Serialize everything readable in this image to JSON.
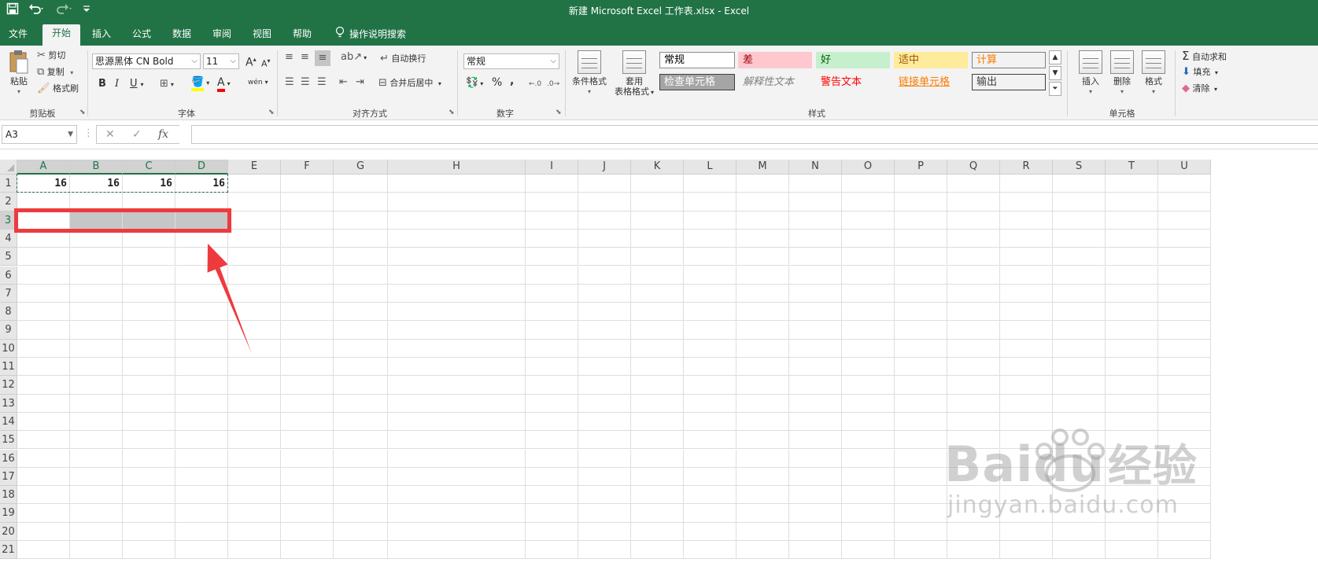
{
  "titlebar": {
    "save_icon": "save-icon",
    "undo_icon": "undo-icon",
    "redo_icon": "redo-icon",
    "customize_icon": "customize-qat-icon",
    "title": "新建 Microsoft Excel 工作表.xlsx  -  Excel"
  },
  "tabs": [
    {
      "label": "文件"
    },
    {
      "label": "开始",
      "active": true
    },
    {
      "label": "插入"
    },
    {
      "label": "公式"
    },
    {
      "label": "数据"
    },
    {
      "label": "审阅"
    },
    {
      "label": "视图"
    },
    {
      "label": "帮助"
    },
    {
      "label": "操作说明搜索",
      "icon": "lightbulb-icon"
    }
  ],
  "ribbon": {
    "clipboard": {
      "paste": "粘贴",
      "cut": "剪切",
      "copy": "复制",
      "format_painter": "格式刷",
      "label": "剪贴板"
    },
    "font": {
      "font_name": "思源黑体 CN Bold",
      "font_size": "11",
      "grow": "A",
      "shrink": "A",
      "bold": "B",
      "italic": "I",
      "underline": "U",
      "font_color": "A",
      "phonetic": "wén",
      "label": "字体"
    },
    "alignment": {
      "wrap_text": "自动换行",
      "merge_center": "合并后居中",
      "label": "对齐方式"
    },
    "number": {
      "format": "常规",
      "percent": "%",
      "comma": ",",
      "label": "数字"
    },
    "styles": {
      "conditional": "条件格式",
      "table_line1": "套用",
      "table_line2": "表格格式",
      "cells": [
        {
          "label": "常规",
          "bg": "#ffffff",
          "fg": "#000000",
          "border": "#8a8a8a"
        },
        {
          "label": "差",
          "bg": "#ffc7ce",
          "fg": "#9c0006",
          "border": "#ffc7ce"
        },
        {
          "label": "好",
          "bg": "#c6efce",
          "fg": "#006100",
          "border": "#c6efce"
        },
        {
          "label": "适中",
          "bg": "#ffeb9c",
          "fg": "#9c5700",
          "border": "#ffeb9c"
        },
        {
          "label": "计算",
          "bg": "#f2f2f2",
          "fg": "#fa7d00",
          "border": "#7f7f7f"
        },
        {
          "label": "检查单元格",
          "bg": "#a5a5a5",
          "fg": "#ffffff",
          "border": "#3f3f3f"
        },
        {
          "label": "解释性文本",
          "bg": "#f3f3f3",
          "fg": "#7f7f7f",
          "border": "#f3f3f3"
        },
        {
          "label": "警告文本",
          "bg": "#f3f3f3",
          "fg": "#ff0000",
          "border": "#f3f3f3"
        },
        {
          "label": "链接单元格",
          "bg": "#f3f3f3",
          "fg": "#fa7d00",
          "border": "#f3f3f3"
        },
        {
          "label": "输出",
          "bg": "#f2f2f2",
          "fg": "#3f3f3f",
          "border": "#3f3f3f"
        }
      ],
      "label": "样式"
    },
    "cells": {
      "insert": "插入",
      "delete": "删除",
      "format": "格式",
      "label": "单元格"
    },
    "editing": {
      "autosum": "自动求和",
      "fill": "填充",
      "clear": "清除"
    }
  },
  "formula_bar": {
    "name_box": "A3",
    "cancel": "✕",
    "enter": "✓",
    "fx": "fx",
    "value": ""
  },
  "sheet": {
    "columns": [
      "A",
      "B",
      "C",
      "D",
      "E",
      "F",
      "G",
      "H",
      "I",
      "J",
      "K",
      "L",
      "M",
      "N",
      "O",
      "P",
      "Q",
      "R",
      "S",
      "T",
      "U"
    ],
    "selected_columns": [
      "A",
      "B",
      "C",
      "D"
    ],
    "rows": [
      "1",
      "2",
      "3",
      "4",
      "5",
      "6",
      "7",
      "8",
      "9",
      "10",
      "11",
      "12",
      "13",
      "14",
      "15",
      "16",
      "17",
      "18",
      "19",
      "20",
      "21"
    ],
    "selected_row": "3",
    "cells": {
      "A1": "16",
      "B1": "16",
      "C1": "16",
      "D1": "16"
    },
    "copy_range": "A1:D1",
    "selection_range": "A3:D3",
    "active_cell": "A3"
  },
  "annotation": {
    "box_color": "#ef3a3d",
    "arrow_color": "#ef3a3d"
  },
  "watermark": {
    "line1": "Bai",
    "line1b": "du",
    "line1c": "经验",
    "line2": "jingyan.baidu.com"
  }
}
